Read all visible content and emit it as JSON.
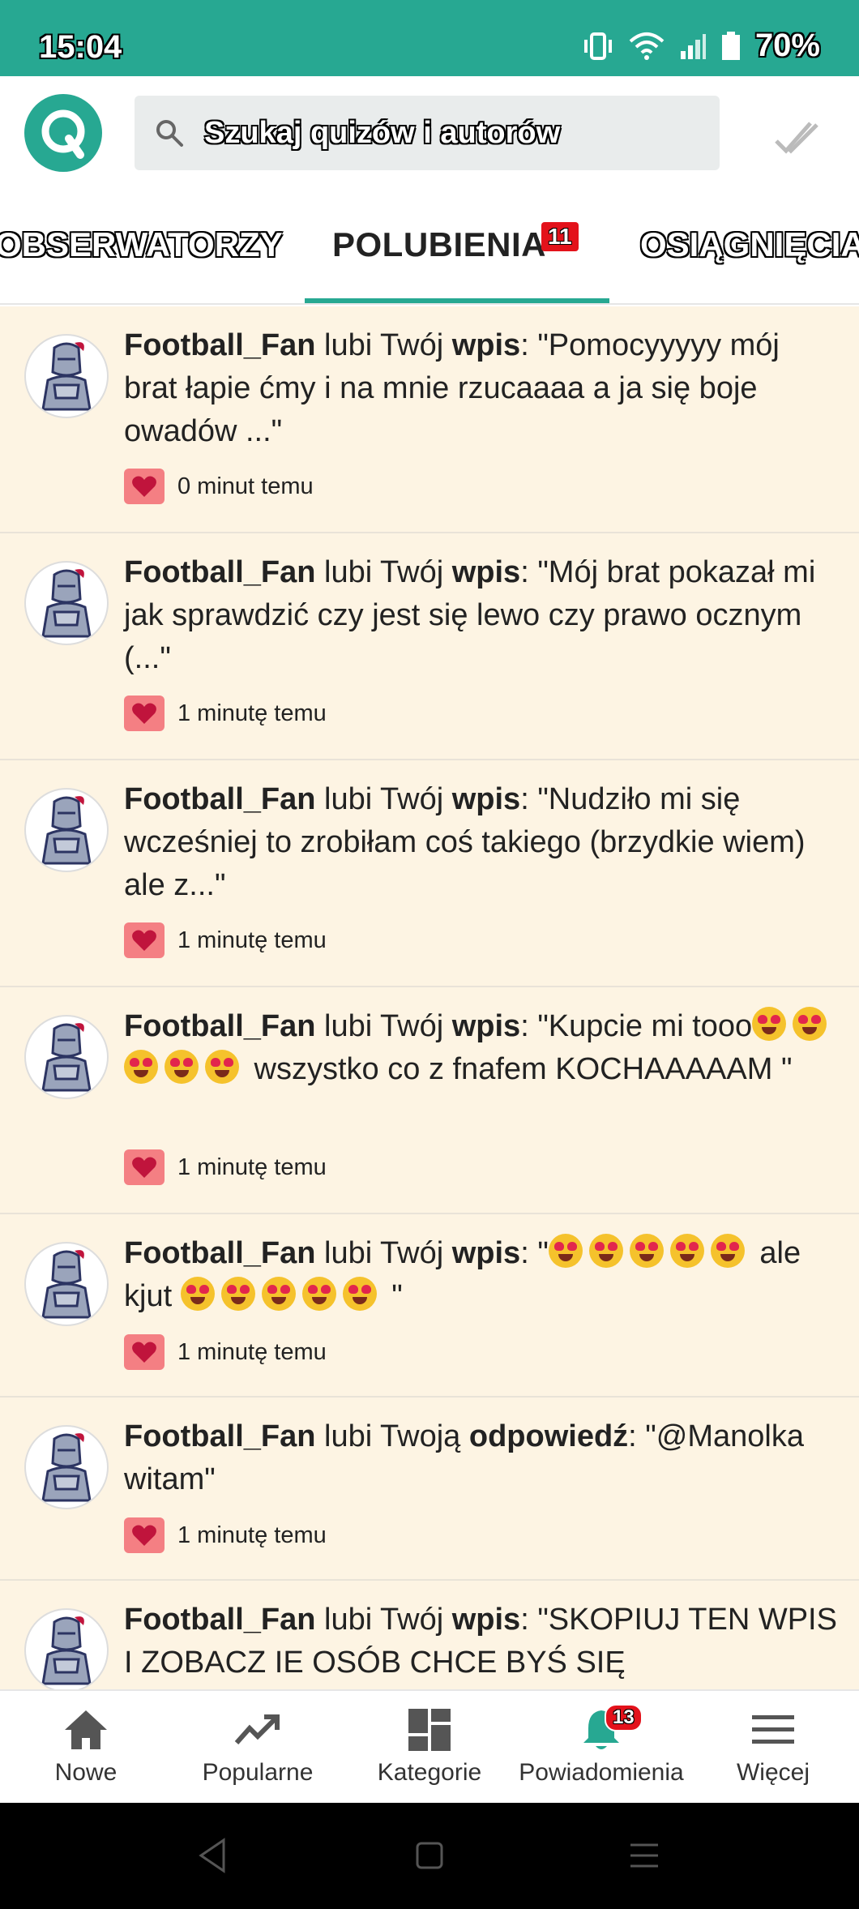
{
  "status_bar": {
    "time": "15:04",
    "battery": "70%"
  },
  "search": {
    "placeholder": "Szukaj quizów i autorów"
  },
  "tabs": [
    {
      "label": "OBSERWATORZY"
    },
    {
      "label": "POLUBIENIA",
      "badge": "11",
      "active": true
    },
    {
      "label": "OSIĄGNIĘCIA"
    }
  ],
  "notifications": [
    {
      "user": "Football_Fan",
      "verb": " lubi Twój ",
      "object": "wpis",
      "text": ": \"Pomocyyyyy mój brat łapie ćmy i na mnie rzucaaaa a ja się boje owadów ...\"",
      "time": "0 minut temu"
    },
    {
      "user": "Football_Fan",
      "verb": " lubi Twój ",
      "object": "wpis",
      "text": ": \"Mój brat pokazał mi jak sprawdzić czy jest się lewo czy prawo ocznym (...\"",
      "time": "1 minutę temu"
    },
    {
      "user": "Football_Fan",
      "verb": " lubi Twój ",
      "object": "wpis",
      "text": ": \"Nudziło mi się wcześniej to zrobiłam coś takiego (brzydkie wiem) ale z...\"",
      "time": "1 minutę temu"
    },
    {
      "user": "Football_Fan",
      "verb": " lubi Twój ",
      "object": "wpis",
      "text_a": ": \"Kupcie mi tooo",
      "text_b": " wszystko co z fnafem KOCHAAAAAM \"",
      "time": "1 minutę temu"
    },
    {
      "user": "Football_Fan",
      "verb": " lubi Twój ",
      "object": "wpis",
      "text_a": ": \"",
      "text_b": " ale kjut ",
      "text_c": " \"",
      "time": "1 minutę temu"
    },
    {
      "user": "Football_Fan",
      "verb": " lubi Twoją ",
      "object": "odpowiedź",
      "text": ": \"@Manolka witam\"",
      "time": "1 minutę temu"
    },
    {
      "user": "Football_Fan",
      "verb": " lubi Twój ",
      "object": "wpis",
      "text": ": \"SKOPIUJ TEN WPIS I ZOBACZ IE OSÓB CHCE BYŚ SIĘ",
      "time": ""
    }
  ],
  "bottom_nav": [
    {
      "label": "Nowe",
      "icon": "home-icon"
    },
    {
      "label": "Popularne",
      "icon": "trending-icon"
    },
    {
      "label": "Kategorie",
      "icon": "grid-icon"
    },
    {
      "label": "Powiadomienia",
      "icon": "bell-icon",
      "badge": "13",
      "active": true
    },
    {
      "label": "Więcej",
      "icon": "menu-icon"
    }
  ],
  "colors": {
    "accent": "#27a892",
    "feed_background": "#fdf4e3",
    "heart": "#c0143c",
    "badge": "#e3121b"
  }
}
